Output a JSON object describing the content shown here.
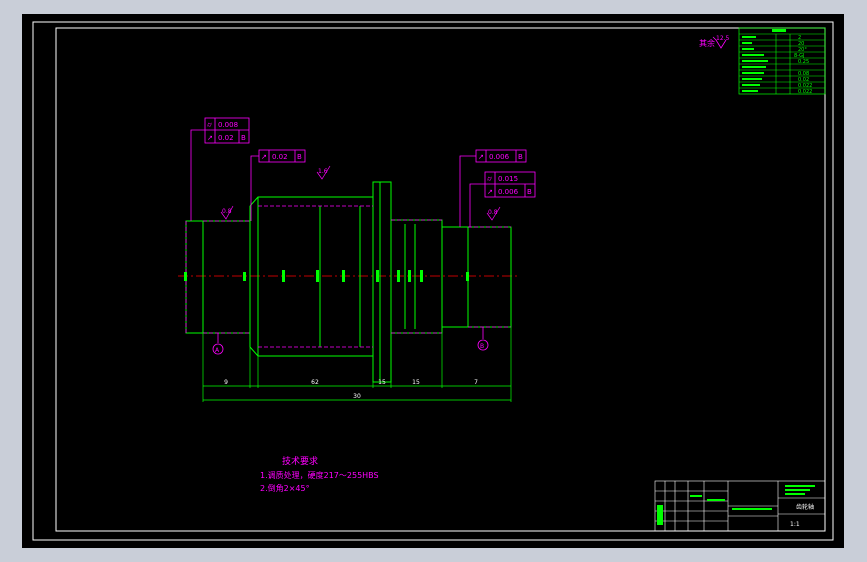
{
  "colors": {
    "background_frame": "#c9ced8",
    "canvas": "#000000",
    "border": "#ffffff",
    "outline": "#00ff00",
    "annotation": "#ff00ff",
    "centerline": "#ff0000",
    "dimension": "#ffffff"
  },
  "surface_finish": {
    "label": "其余",
    "value": "12.5"
  },
  "roughness_marks": [
    "1.6",
    "0.8",
    "1.6",
    "0.8"
  ],
  "gdt_frames": [
    {
      "symbol": "⌭",
      "value": "0.008",
      "datum": ""
    },
    {
      "symbol": "↗",
      "value": "0.02",
      "datum": "B"
    },
    {
      "symbol": "↗",
      "value": "0.02",
      "datum": "B"
    },
    {
      "symbol": "↗",
      "value": "0.006",
      "datum": "B"
    },
    {
      "symbol": "⌭",
      "value": "0.015",
      "datum": ""
    },
    {
      "symbol": "↗",
      "value": "0.006",
      "datum": "B"
    }
  ],
  "datum_markers": [
    "A",
    "B"
  ],
  "dimensions": {
    "seg1": "9",
    "seg2": "62",
    "seg3": "15",
    "seg4": "15",
    "seg5": "7",
    "overall": "30"
  },
  "tech_requirements": {
    "title": "技术要求",
    "item1": "1.调质处理，硬度217～255HBS",
    "item2": "2.倒角2×45°"
  },
  "title_block": {
    "part_name": "齿轮轴",
    "scale": "1:1"
  },
  "param_table": {
    "values": [
      "2",
      "20",
      "20°",
      "8-GJ",
      "0.25",
      "0.08",
      "0.02",
      "0.022",
      "0.022"
    ]
  }
}
